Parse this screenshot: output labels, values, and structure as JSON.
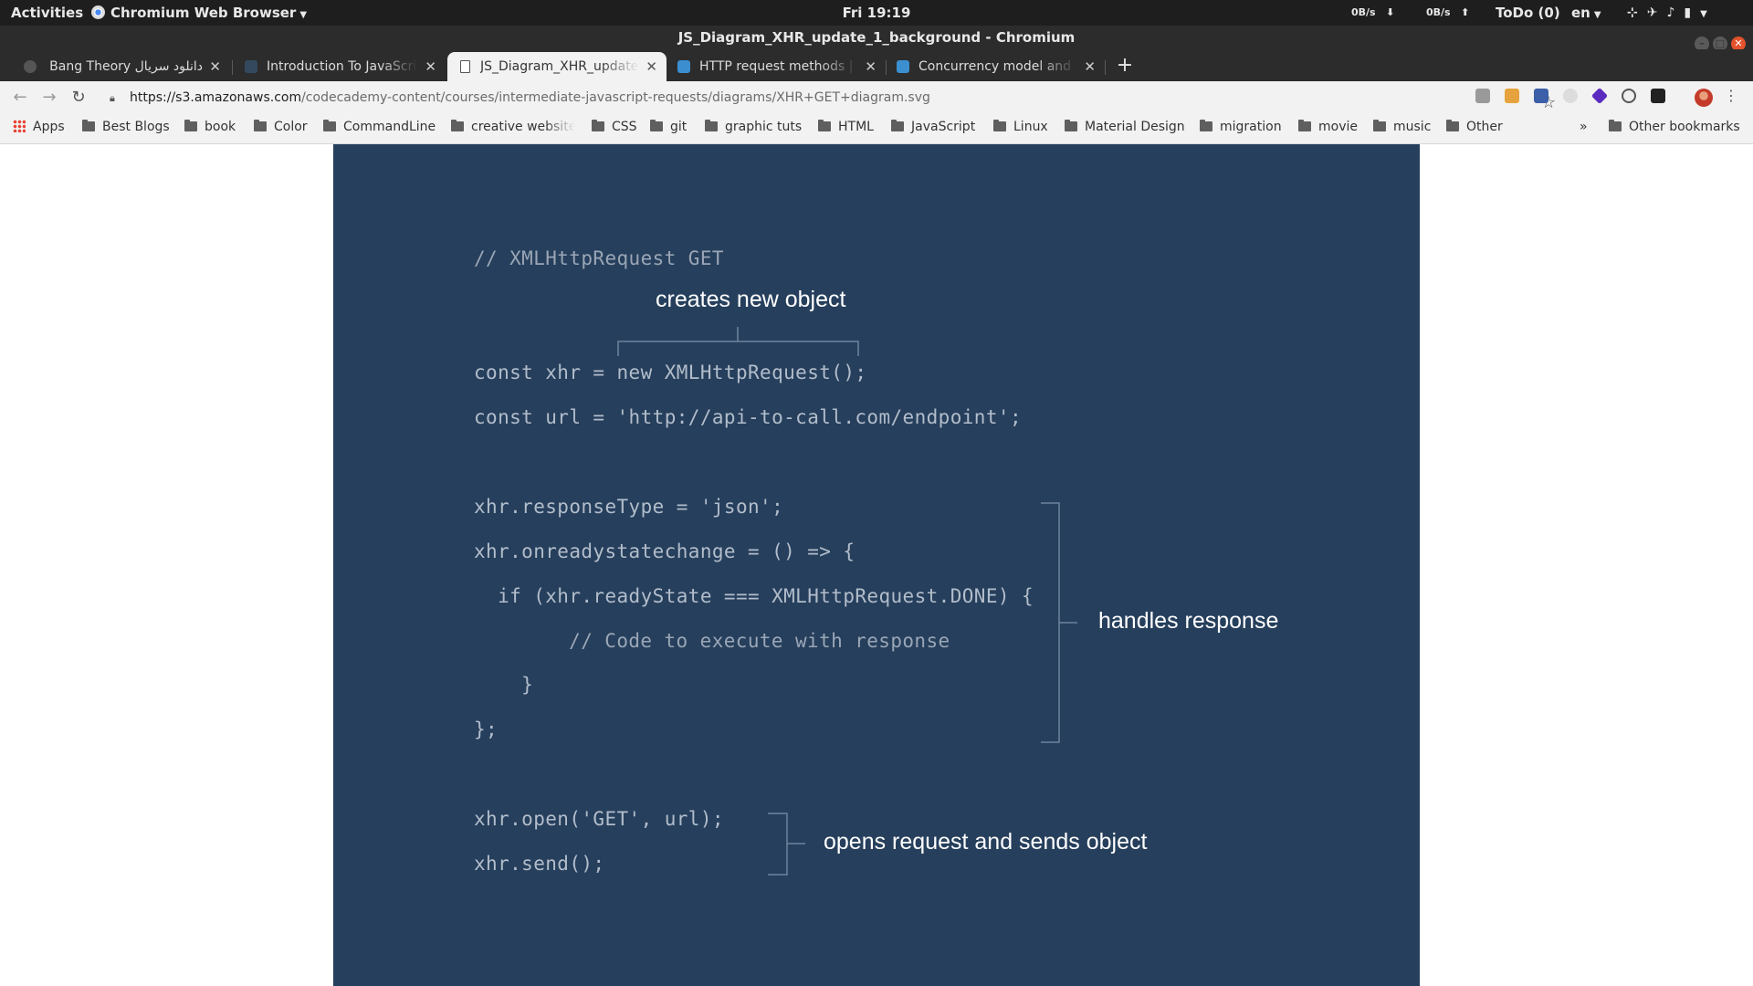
{
  "topbar": {
    "activities": "Activities",
    "app_name": "Chromium Web Browser",
    "clock": "Fri 19:19",
    "net_down": "0B/s",
    "net_up": "0B/s",
    "todo": "ToDo (0)",
    "lang": "en"
  },
  "window": {
    "title": "JS_Diagram_XHR_update_1_background - Chromium"
  },
  "tabs": [
    {
      "title": "دانلود سریال Bang Theory",
      "favicon_color": "#555555",
      "active": false
    },
    {
      "title": "Introduction To JavaScrip",
      "favicon_color": "#34495e",
      "active": false
    },
    {
      "title": "JS_Diagram_XHR_update",
      "favicon_color": "#ffffff",
      "active": true
    },
    {
      "title": "HTTP request methods | M",
      "favicon_color": "#3b8fd1",
      "active": false
    },
    {
      "title": "Concurrency model and E",
      "favicon_color": "#3b8fd1",
      "active": false
    }
  ],
  "toolbar": {
    "url_host": "https://s3.amazonaws.com",
    "url_path": "/codecademy-content/courses/intermediate-javascript-requests/diagrams/XHR+GET+diagram.svg"
  },
  "bookmarks": {
    "apps": "Apps",
    "items": [
      "Best Blogs",
      "book",
      "Color",
      "CommandLine",
      "creative website",
      "CSS",
      "git",
      "graphic tuts",
      "HTML",
      "JavaScript",
      "Linux",
      "Material Design",
      "migration",
      "movie",
      "music",
      "Other"
    ],
    "chevron": "»",
    "other": "Other bookmarks"
  },
  "diagram": {
    "background": "#263f5c",
    "code_lines": [
      "// XMLHttpRequest GET",
      "const xhr = new XMLHttpRequest();",
      "const url = 'http://api-to-call.com/endpoint';",
      "xhr.responseType = 'json';",
      "xhr.onreadystatechange = () => {",
      "  if (xhr.readyState === XMLHttpRequest.DONE) {",
      "    // Code to execute with response",
      "    }",
      "};",
      "xhr.open('GET', url);",
      "xhr.send();"
    ],
    "annotations": {
      "creates": "creates new object",
      "handles": "handles response",
      "opens": "opens  request and sends object"
    }
  }
}
